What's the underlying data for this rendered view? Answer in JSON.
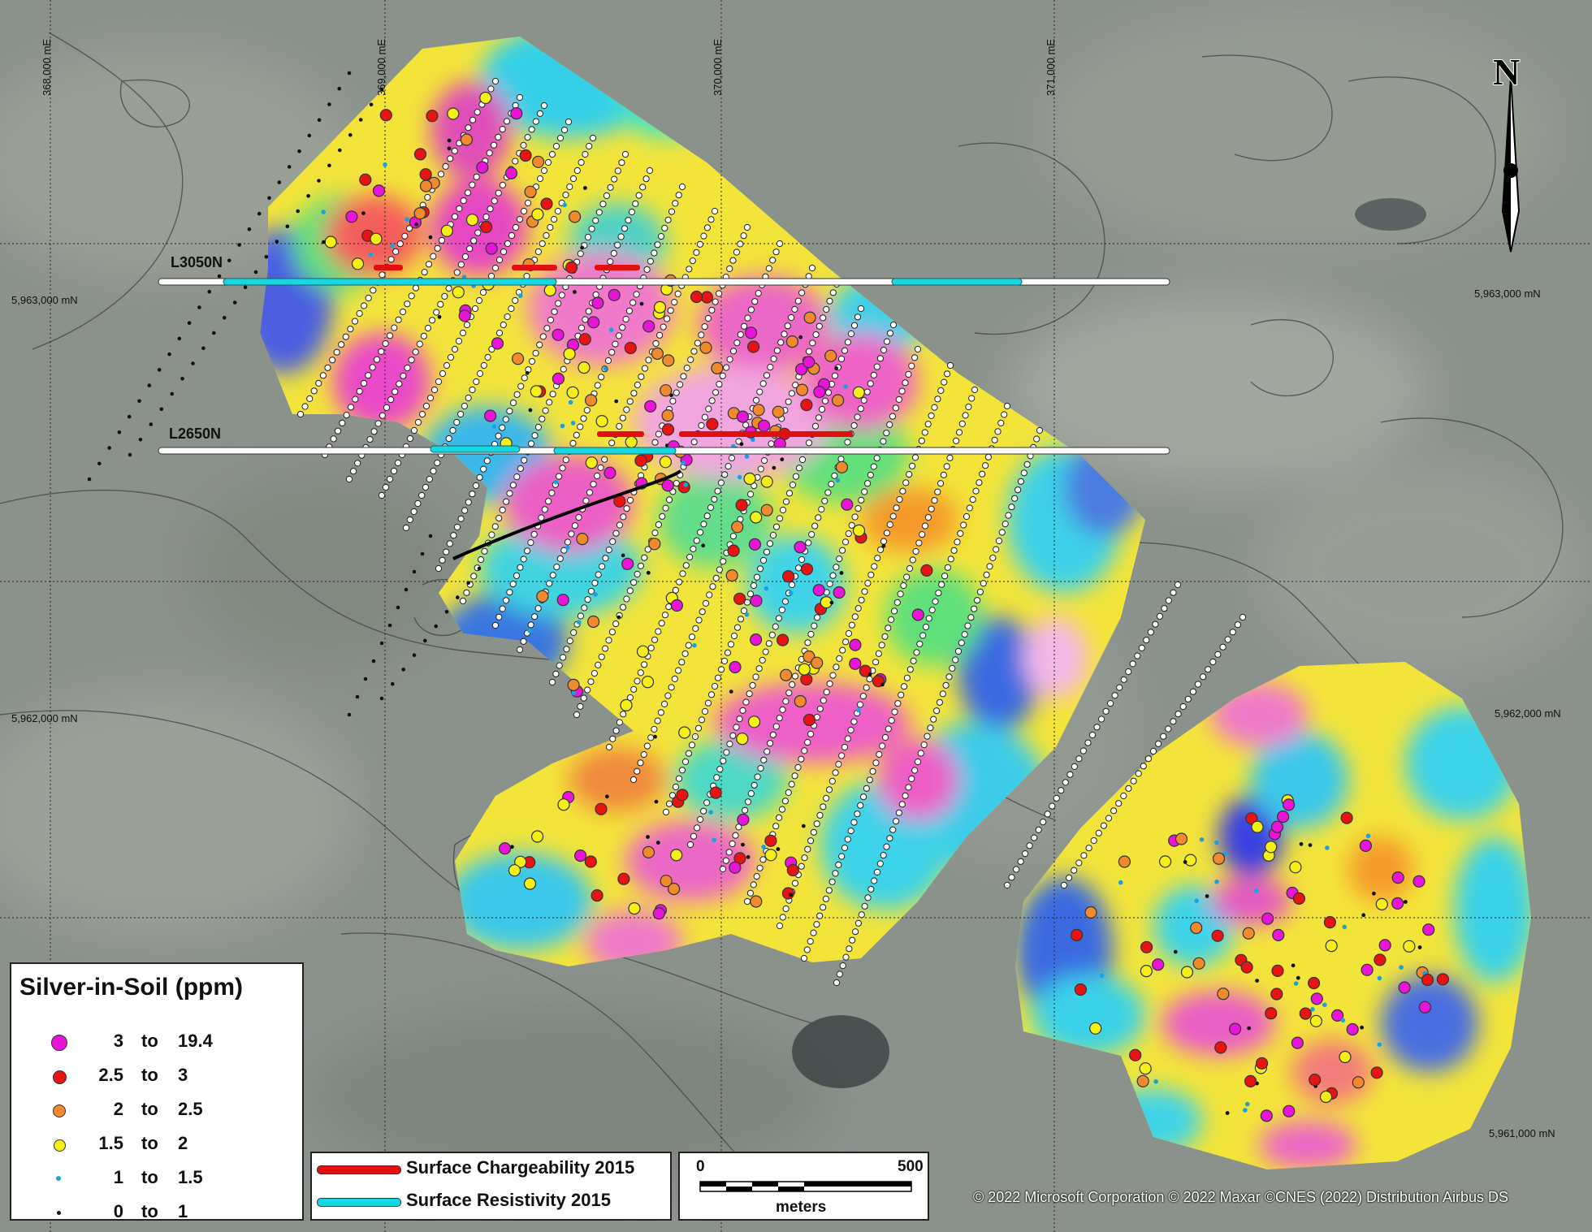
{
  "grid": {
    "easting_labels": [
      "368,000 mE",
      "369,000 mE",
      "370,000 mE",
      "371,000 mE"
    ],
    "northing_labels": [
      "5,963,000 mN",
      "5,962,000 mN",
      "5,961,000 mN"
    ]
  },
  "survey_lines": [
    {
      "label": "L3050N"
    },
    {
      "label": "L2650N"
    }
  ],
  "north_arrow": {
    "label": "N"
  },
  "legend": {
    "title": "Silver-in-Soil (ppm)",
    "classes": [
      {
        "lo": "3",
        "to": "to",
        "hi": "19.4",
        "color": "#e815d8"
      },
      {
        "lo": "2.5",
        "to": "to",
        "hi": "3",
        "color": "#e81414"
      },
      {
        "lo": "2",
        "to": "to",
        "hi": "2.5",
        "color": "#f08a2c"
      },
      {
        "lo": "1.5",
        "to": "to",
        "hi": "2",
        "color": "#f5ee17"
      },
      {
        "lo": "1",
        "to": "to",
        "hi": "1.5",
        "color": "#17a3e0"
      },
      {
        "lo": "0",
        "to": "to",
        "hi": "1",
        "color": "#111111"
      }
    ]
  },
  "survey_legend": {
    "chargeability": {
      "label": "Surface Chargeability 2015",
      "color": "#e01010"
    },
    "resistivity": {
      "label": "Surface Resistivity 2015",
      "color": "#17d7e0"
    }
  },
  "scale_bar": {
    "start": "0",
    "end": "500",
    "unit": "meters"
  },
  "credit": "© 2022 Microsoft Corporation © 2022 Maxar ©CNES (2022) Distribution Airbus DS"
}
